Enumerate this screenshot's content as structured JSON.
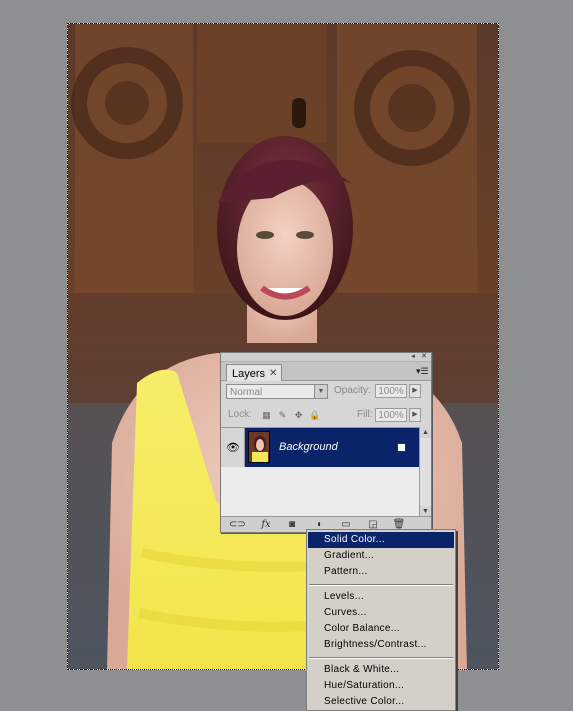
{
  "layers_panel": {
    "tab_label": "Layers",
    "tab_close": "✕",
    "blend_mode": "Normal",
    "opacity_label": "Opacity:",
    "opacity_value": "100%",
    "lock_label": "Lock:",
    "fill_label": "Fill:",
    "fill_value": "100%",
    "layers": [
      {
        "name": "Background",
        "visible": true,
        "locked": true,
        "selected": true
      }
    ],
    "bottom_icons": [
      "link-layers-icon",
      "fx-icon",
      "add-mask-icon",
      "adjustment-layer-icon",
      "new-group-icon",
      "new-layer-icon",
      "trash-icon"
    ],
    "fx_label": "fx"
  },
  "adjustment_menu": {
    "groups": [
      [
        "Solid Color...",
        "Gradient...",
        "Pattern..."
      ],
      [
        "Levels...",
        "Curves...",
        "Color Balance...",
        "Brightness/Contrast..."
      ],
      [
        "Black & White...",
        "Hue/Saturation...",
        "Selective Color..."
      ]
    ],
    "selected": "Solid Color..."
  },
  "colors": {
    "workspace": "#8e8f91",
    "panel": "#d6d6d6",
    "selection_blue": "#0a246a",
    "menu_bg": "#d4d0c8"
  }
}
